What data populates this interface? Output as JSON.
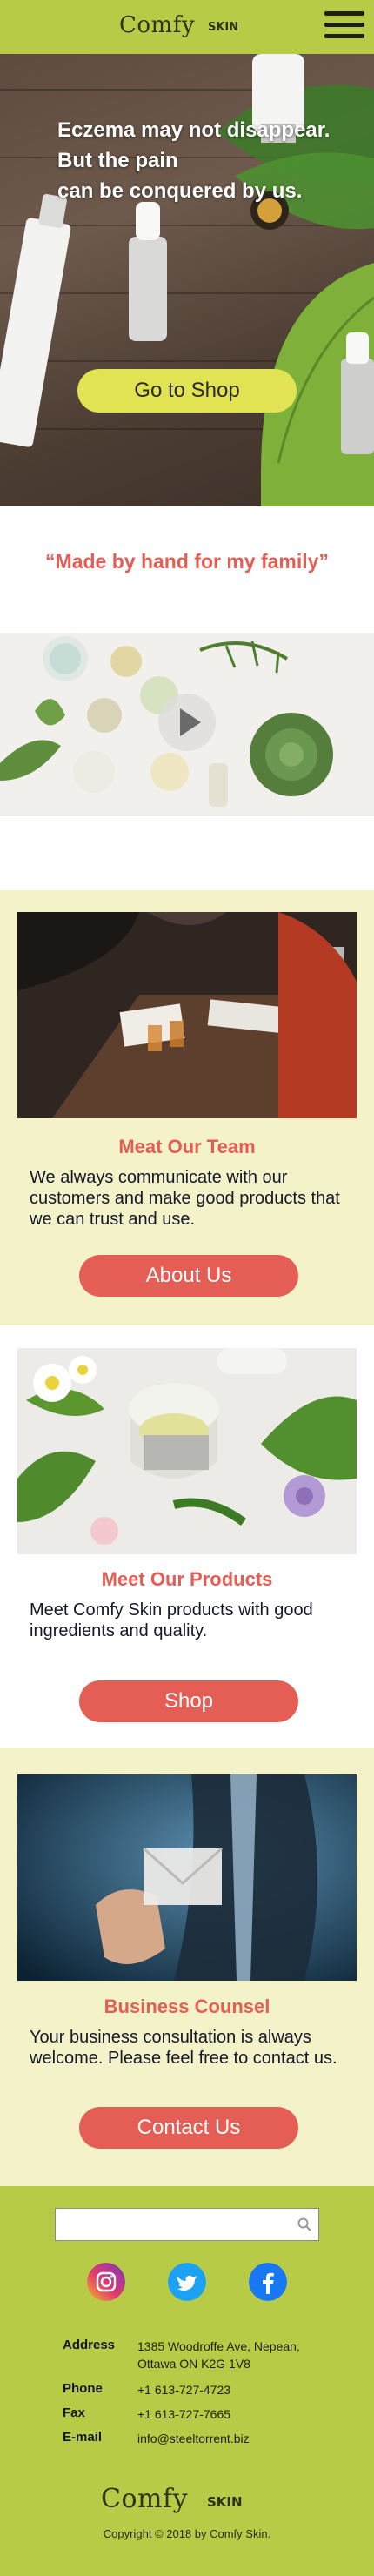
{
  "header": {
    "logo_text": "Comfy",
    "logo_sub": "SKIN"
  },
  "hero": {
    "line1": "Eczema may not disappear.",
    "line2": "But the pain",
    "line3": "can be conquered by us.",
    "cta_label": "Go to Shop"
  },
  "quote": "“Made by hand for my family”",
  "team": {
    "title": "Meat Our Team",
    "text": "We always communicate with our customers and make good products that we can trust and use.",
    "button": "About Us"
  },
  "products": {
    "title": "Meet Our Products",
    "text": "Meet Comfy Skin products with good ingredients and quality.",
    "button": "Shop"
  },
  "counsel": {
    "title": "Business Counsel",
    "text": "Your business consultation is always welcome. Please feel free to contact us.",
    "button": "Contact Us"
  },
  "footer": {
    "search_placeholder": "",
    "social": [
      "instagram-icon",
      "twitter-icon",
      "facebook-icon"
    ],
    "address_label": "Address",
    "address_value": "1385 Woodroffe Ave, Nepean, Ottawa ON K2G 1V8",
    "phone_label": "Phone",
    "phone_value": "+1 613-727-4723",
    "fax_label": "Fax",
    "fax_value": "+1 613-727-7665",
    "email_label": "E-mail",
    "email_value": "info@steeltorrent.biz",
    "logo_text": "Comfy",
    "logo_sub": "SKIN",
    "copyright": "Copyright © 2018 by Comfy Skin."
  },
  "colors": {
    "brand_green": "#b7cb47",
    "accent_red": "#e45e55",
    "section_cream": "#f4f2c8",
    "cta_yellow": "#e2e352"
  }
}
